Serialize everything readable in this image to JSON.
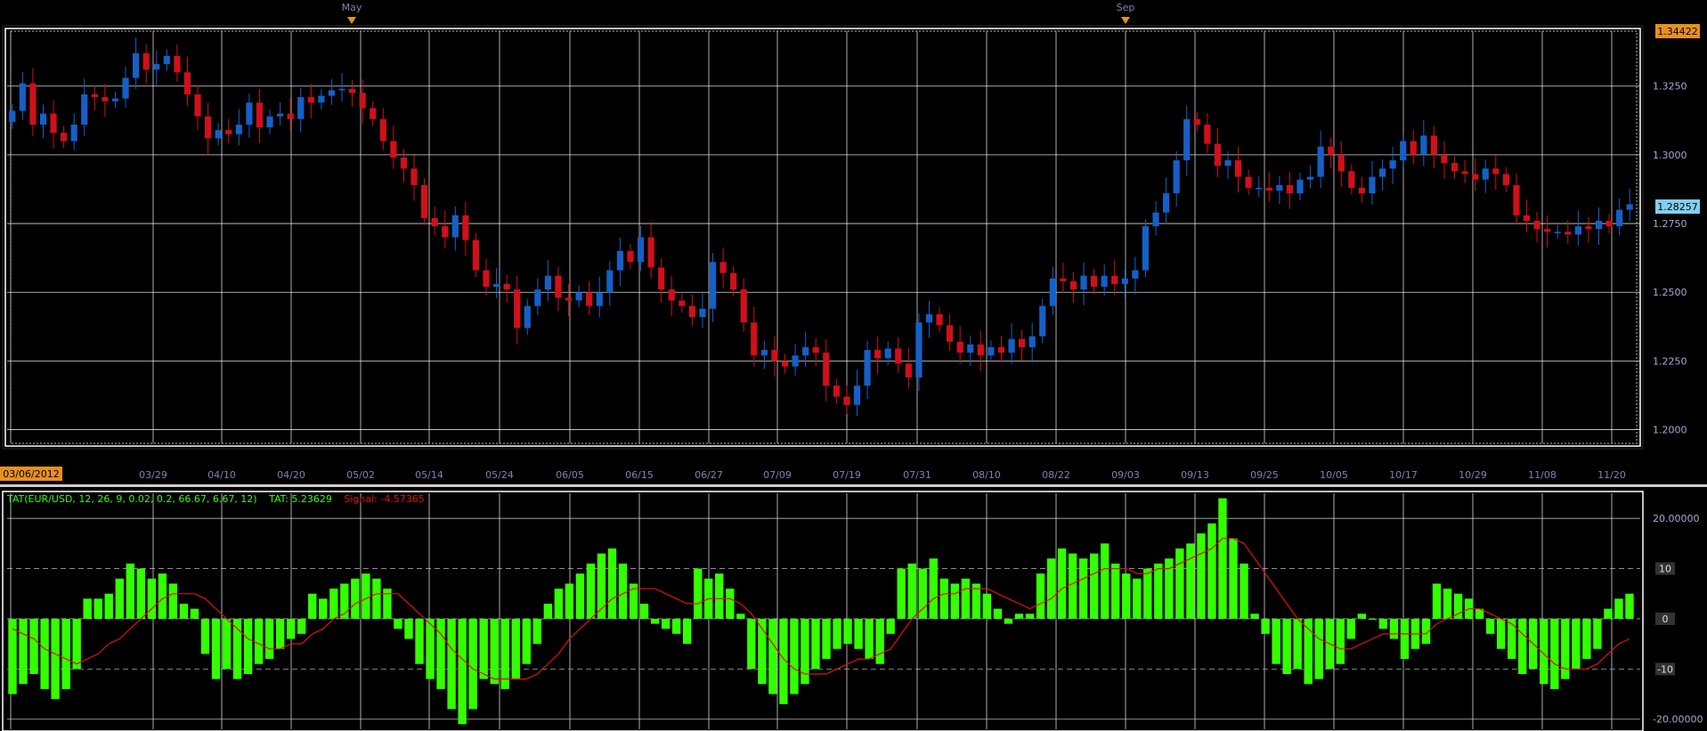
{
  "chart_data": [
    {
      "type": "candlestick",
      "ylim": [
        1.195,
        1.345
      ],
      "y_ticks": [
        "1.3250",
        "1.3000",
        "1.2750",
        "1.2500",
        "1.2250",
        "1.2000"
      ],
      "y_tick_values": [
        1.325,
        1.3,
        1.275,
        1.25,
        1.225,
        1.2
      ],
      "x_ticks": [
        "03/29",
        "04/10",
        "04/20",
        "05/02",
        "05/14",
        "05/24",
        "06/05",
        "06/15",
        "06/27",
        "07/09",
        "07/19",
        "07/31",
        "08/10",
        "08/22",
        "09/03",
        "09/13",
        "09/25",
        "10/05",
        "10/17",
        "10/29",
        "11/08",
        "11/20"
      ],
      "month_markers": [
        "May",
        "Sep"
      ],
      "start_date_label": "03/06/2012",
      "high_price_label": "1.34422",
      "last_price_label": "1.28257",
      "up_color": "#1560c8",
      "down_color": "#d0101a",
      "grid": true,
      "close": [
        1.316,
        1.326,
        1.311,
        1.315,
        1.308,
        1.305,
        1.311,
        1.322,
        1.321,
        1.3195,
        1.3205,
        1.328,
        1.337,
        1.331,
        1.333,
        1.336,
        1.33,
        1.322,
        1.314,
        1.306,
        1.309,
        1.3075,
        1.311,
        1.319,
        1.31,
        1.314,
        1.315,
        1.313,
        1.321,
        1.319,
        1.3215,
        1.3235,
        1.324,
        1.3225,
        1.317,
        1.313,
        1.305,
        1.299,
        1.295,
        1.289,
        1.277,
        1.274,
        1.27,
        1.278,
        1.269,
        1.258,
        1.252,
        1.253,
        1.251,
        1.237,
        1.245,
        1.251,
        1.256,
        1.248,
        1.247,
        1.25,
        1.245,
        1.25,
        1.258,
        1.265,
        1.261,
        1.27,
        1.259,
        1.251,
        1.247,
        1.245,
        1.241,
        1.244,
        1.261,
        1.257,
        1.251,
        1.239,
        1.227,
        1.229,
        1.225,
        1.223,
        1.227,
        1.23,
        1.228,
        1.216,
        1.212,
        1.209,
        1.216,
        1.229,
        1.226,
        1.2295,
        1.224,
        1.219,
        1.239,
        1.242,
        1.238,
        1.232,
        1.228,
        1.231,
        1.227,
        1.23,
        1.228,
        1.233,
        1.23,
        1.234,
        1.245,
        1.255,
        1.254,
        1.251,
        1.256,
        1.252,
        1.256,
        1.253,
        1.255,
        1.258,
        1.274,
        1.279,
        1.286,
        1.298,
        1.313,
        1.311,
        1.304,
        1.296,
        1.298,
        1.292,
        1.288,
        1.288,
        1.287,
        1.289,
        1.286,
        1.291,
        1.292,
        1.303,
        1.3,
        1.294,
        1.288,
        1.286,
        1.292,
        1.295,
        1.298,
        1.305,
        1.3,
        1.307,
        1.3,
        1.297,
        1.294,
        1.293,
        1.291,
        1.295,
        1.293,
        1.289,
        1.278,
        1.276,
        1.273,
        1.272,
        1.272,
        1.271,
        1.274,
        1.273,
        1.276,
        1.274,
        1.28,
        1.282
      ],
      "series_note_ref": "close"
    },
    {
      "type": "bar",
      "indicator_label": "TAT(EUR/USD, 12, 26, 9, 0.02, 0.2, 66.67, 6.67, 12)",
      "tat_label": "TAT: 5.23629",
      "signal_label": "Signal: -4.57365",
      "ylim": [
        -22,
        25
      ],
      "y_ticks": [
        "20.00000",
        "10",
        "0",
        "-10",
        "-20.00000"
      ],
      "y_tick_values": [
        20,
        10,
        0,
        -10,
        -20
      ],
      "bar_color": "#33ff00",
      "signal_color": "#e01010",
      "values": [
        -15,
        -13,
        -11,
        -14,
        -16,
        -14,
        -10,
        4,
        4,
        5,
        8,
        11,
        10,
        8,
        9,
        7,
        3,
        2,
        -7,
        -12,
        -10,
        -12,
        -11,
        -9,
        -8,
        -6,
        -4,
        -3,
        5,
        4,
        6,
        7,
        8,
        9,
        8,
        6,
        -2,
        -4,
        -9,
        -12,
        -14,
        -18,
        -21,
        -18,
        -12,
        -13,
        -14,
        -12,
        -9,
        -5,
        3,
        6,
        7,
        9,
        11,
        13,
        14,
        11,
        7,
        3,
        -1,
        -2,
        -3,
        -5,
        10,
        8,
        9,
        6,
        1,
        -10,
        -13,
        -15,
        -17,
        -15,
        -13,
        -10,
        -8,
        -6,
        -5,
        -6,
        -8,
        -9,
        -3,
        10,
        11,
        10,
        12,
        8,
        7,
        8,
        7,
        5,
        2,
        -1,
        1,
        1,
        9,
        12,
        14,
        13,
        12,
        13,
        15,
        11,
        9,
        8,
        10,
        11,
        12,
        14,
        15,
        17,
        19,
        24,
        16,
        11,
        1,
        -3,
        -9,
        -11,
        -10,
        -13,
        -12,
        -10,
        -9,
        -4,
        1,
        0,
        -2,
        -4,
        -8,
        -6,
        -5,
        7,
        6,
        5,
        4,
        2,
        -3,
        -6,
        -8,
        -11,
        -10,
        -13,
        -14,
        -12,
        -10,
        -8,
        -6,
        2,
        4,
        5
      ],
      "signal": [
        -2,
        -3,
        -4,
        -6,
        -7,
        -8,
        -9,
        -8,
        -7,
        -5,
        -4,
        -2,
        0,
        2,
        4,
        5,
        5,
        5,
        4,
        2,
        0,
        -2,
        -4,
        -5,
        -6,
        -6,
        -5,
        -5,
        -3,
        -2,
        0,
        1,
        3,
        4,
        5,
        5,
        5,
        3,
        1,
        -1,
        -3,
        -6,
        -8,
        -10,
        -11,
        -12,
        -12,
        -12,
        -12,
        -11,
        -9,
        -7,
        -4,
        -2,
        0,
        2,
        4,
        5,
        6,
        6,
        6,
        5,
        4,
        3,
        3,
        4,
        4,
        4,
        3,
        1,
        -2,
        -5,
        -8,
        -10,
        -11,
        -11,
        -11,
        -10,
        -9,
        -8,
        -8,
        -7,
        -6,
        -3,
        0,
        2,
        4,
        5,
        5,
        6,
        6,
        6,
        5,
        4,
        3,
        2,
        3,
        4,
        6,
        7,
        8,
        9,
        10,
        10,
        10,
        9,
        9,
        10,
        10,
        11,
        12,
        13,
        14,
        16,
        16,
        15,
        12,
        9,
        6,
        3,
        0,
        -2,
        -4,
        -5,
        -6,
        -6,
        -5,
        -4,
        -3,
        -3,
        -3,
        -3,
        -3,
        -1,
        0,
        1,
        2,
        2,
        1,
        0,
        -1,
        -3,
        -5,
        -7,
        -9,
        -10,
        -10,
        -10,
        -9,
        -7,
        -5,
        -4
      ]
    }
  ]
}
